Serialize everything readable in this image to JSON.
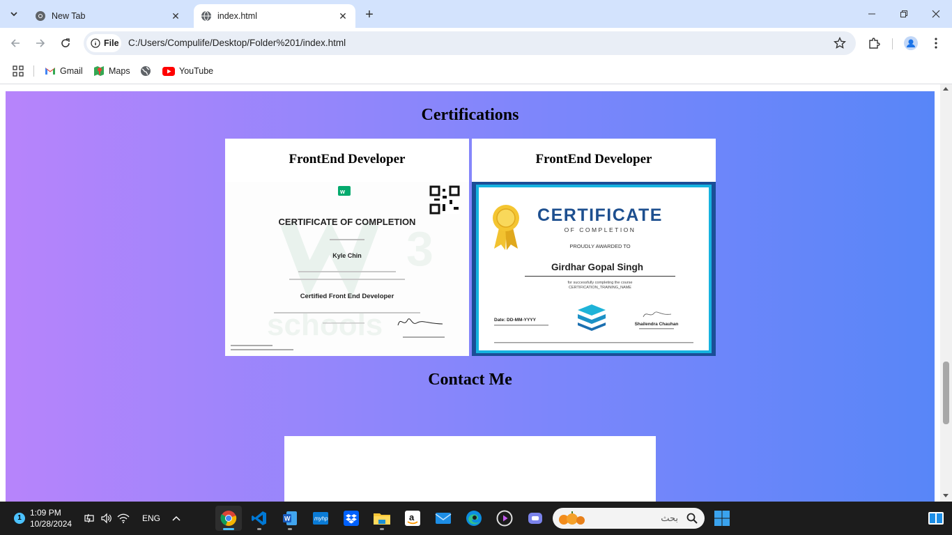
{
  "browser": {
    "tabs": [
      {
        "label": "New Tab",
        "active": false
      },
      {
        "label": "index.html",
        "active": true
      }
    ],
    "omnibox": {
      "scheme_chip": "File",
      "url": "C:/Users/Compulife/Desktop/Folder%201/index.html"
    },
    "bookmarks": [
      {
        "label": "Gmail",
        "icon": "gmail-icon"
      },
      {
        "label": "Maps",
        "icon": "maps-icon"
      },
      {
        "label": "",
        "icon": "globe-icon"
      },
      {
        "label": "YouTube",
        "icon": "youtube-icon"
      }
    ]
  },
  "page": {
    "certifications": {
      "title": "Certifications",
      "cards": [
        {
          "title": "FrontEnd Developer",
          "certificate": {
            "heading": "CERTIFICATE OF COMPLETION",
            "name": "Kyle Chin",
            "course": "Certified Front End Developer",
            "brand": "w3schools"
          }
        },
        {
          "title": "FrontEnd Developer",
          "certificate": {
            "heading": "CERTIFICATE",
            "subheading": "OF COMPLETION",
            "awarded": "PROUDLY AWARDED TO",
            "name": "Girdhar Gopal Singh",
            "course_line1": "for successfully completing the course",
            "course_line2": "CERTIFICATION_TRAINING_NAME",
            "date": "Date: DD-MM-YYYY",
            "signer": "Shailendra Chauhan"
          }
        }
      ]
    },
    "contact": {
      "title": "Contact Me"
    }
  },
  "taskbar": {
    "notification_count": "1",
    "time": "1:09 PM",
    "date": "10/28/2024",
    "language": "ENG",
    "search_placeholder": "بحث",
    "apps": [
      "chrome-icon",
      "vscode-icon",
      "word-icon",
      "myhp-icon",
      "dropbox-icon",
      "file-explorer-icon",
      "amazon-icon",
      "mail-icon",
      "edge-icon",
      "media-player-icon",
      "teams-icon"
    ]
  },
  "colors": {
    "tab_strip": "#d3e3fd",
    "page_gradient_start": "#b784fb",
    "page_gradient_end": "#5886f8",
    "taskbar": "#1c1c1c",
    "accent": "#4cc2ff"
  }
}
